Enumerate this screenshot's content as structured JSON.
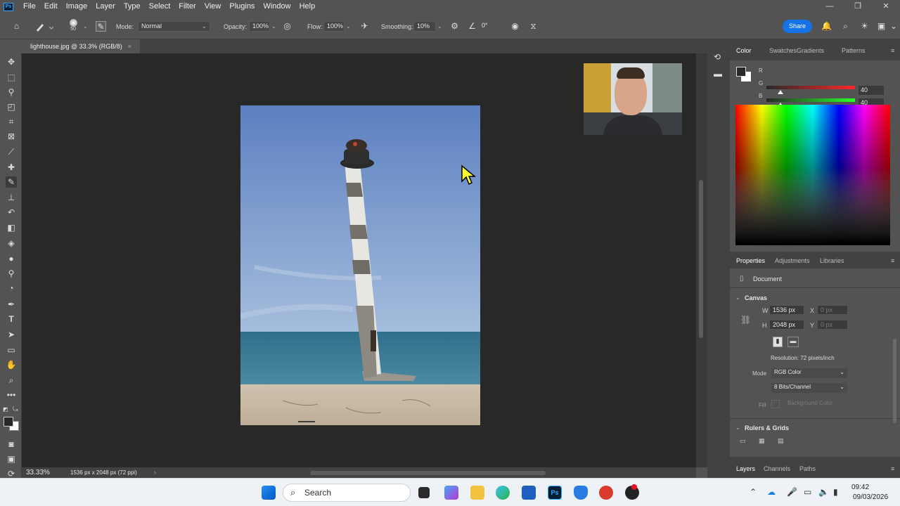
{
  "app": {
    "logo": "Ps",
    "window_controls": [
      "minimize-icon",
      "maximize-icon",
      "close-icon"
    ]
  },
  "menu": [
    "File",
    "Edit",
    "Image",
    "Layer",
    "Type",
    "Select",
    "Filter",
    "View",
    "Plugins",
    "Window",
    "Help"
  ],
  "options": {
    "brush_size": "50",
    "mode_label": "Mode:",
    "mode_value": "Normal",
    "opacity_label": "Opacity:",
    "opacity_value": "100%",
    "flow_label": "Flow:",
    "flow_value": "100%",
    "smoothing_label": "Smoothing:",
    "smoothing_value": "10%",
    "angle_value": "0°",
    "share_label": "Share"
  },
  "document": {
    "tab_title": "lighthouse.jpg @ 33.3% (RGB/8)",
    "zoom": "33.33%",
    "status": "1536 px x 2048 px (72 ppi)"
  },
  "color_panel": {
    "tabs": [
      "Color",
      "Swatches",
      "Gradients",
      "Patterns"
    ],
    "r_label": "R",
    "g_label": "G",
    "b_label": "B",
    "r": "40",
    "g": "40",
    "b": "40",
    "foreground": "#282828",
    "background": "#ffffff"
  },
  "properties": {
    "tabs": [
      "Properties",
      "Adjustments",
      "Libraries"
    ],
    "document_label": "Document",
    "canvas_heading": "Canvas",
    "w_label": "W",
    "w_value": "1536 px",
    "h_label": "H",
    "h_value": "2048 px",
    "x_label": "X",
    "x_placeholder": "0 px",
    "y_label": "Y",
    "y_placeholder": "0 px",
    "resolution": "Resolution: 72 pixels/inch",
    "mode_label": "Mode",
    "mode_value": "RGB Color",
    "depth_value": "8 Bits/Channel",
    "fill_label": "Fill",
    "fill_value": "Background Color",
    "rulers_heading": "Rulers & Grids"
  },
  "layers_tabs": [
    "Layers",
    "Channels",
    "Paths"
  ],
  "taskbar": {
    "search_placeholder": "Search",
    "time": "09:42",
    "date": "09/03/2026"
  },
  "colors": {
    "accent": "#1473e6",
    "panel": "#424242",
    "workspace": "#282828"
  }
}
